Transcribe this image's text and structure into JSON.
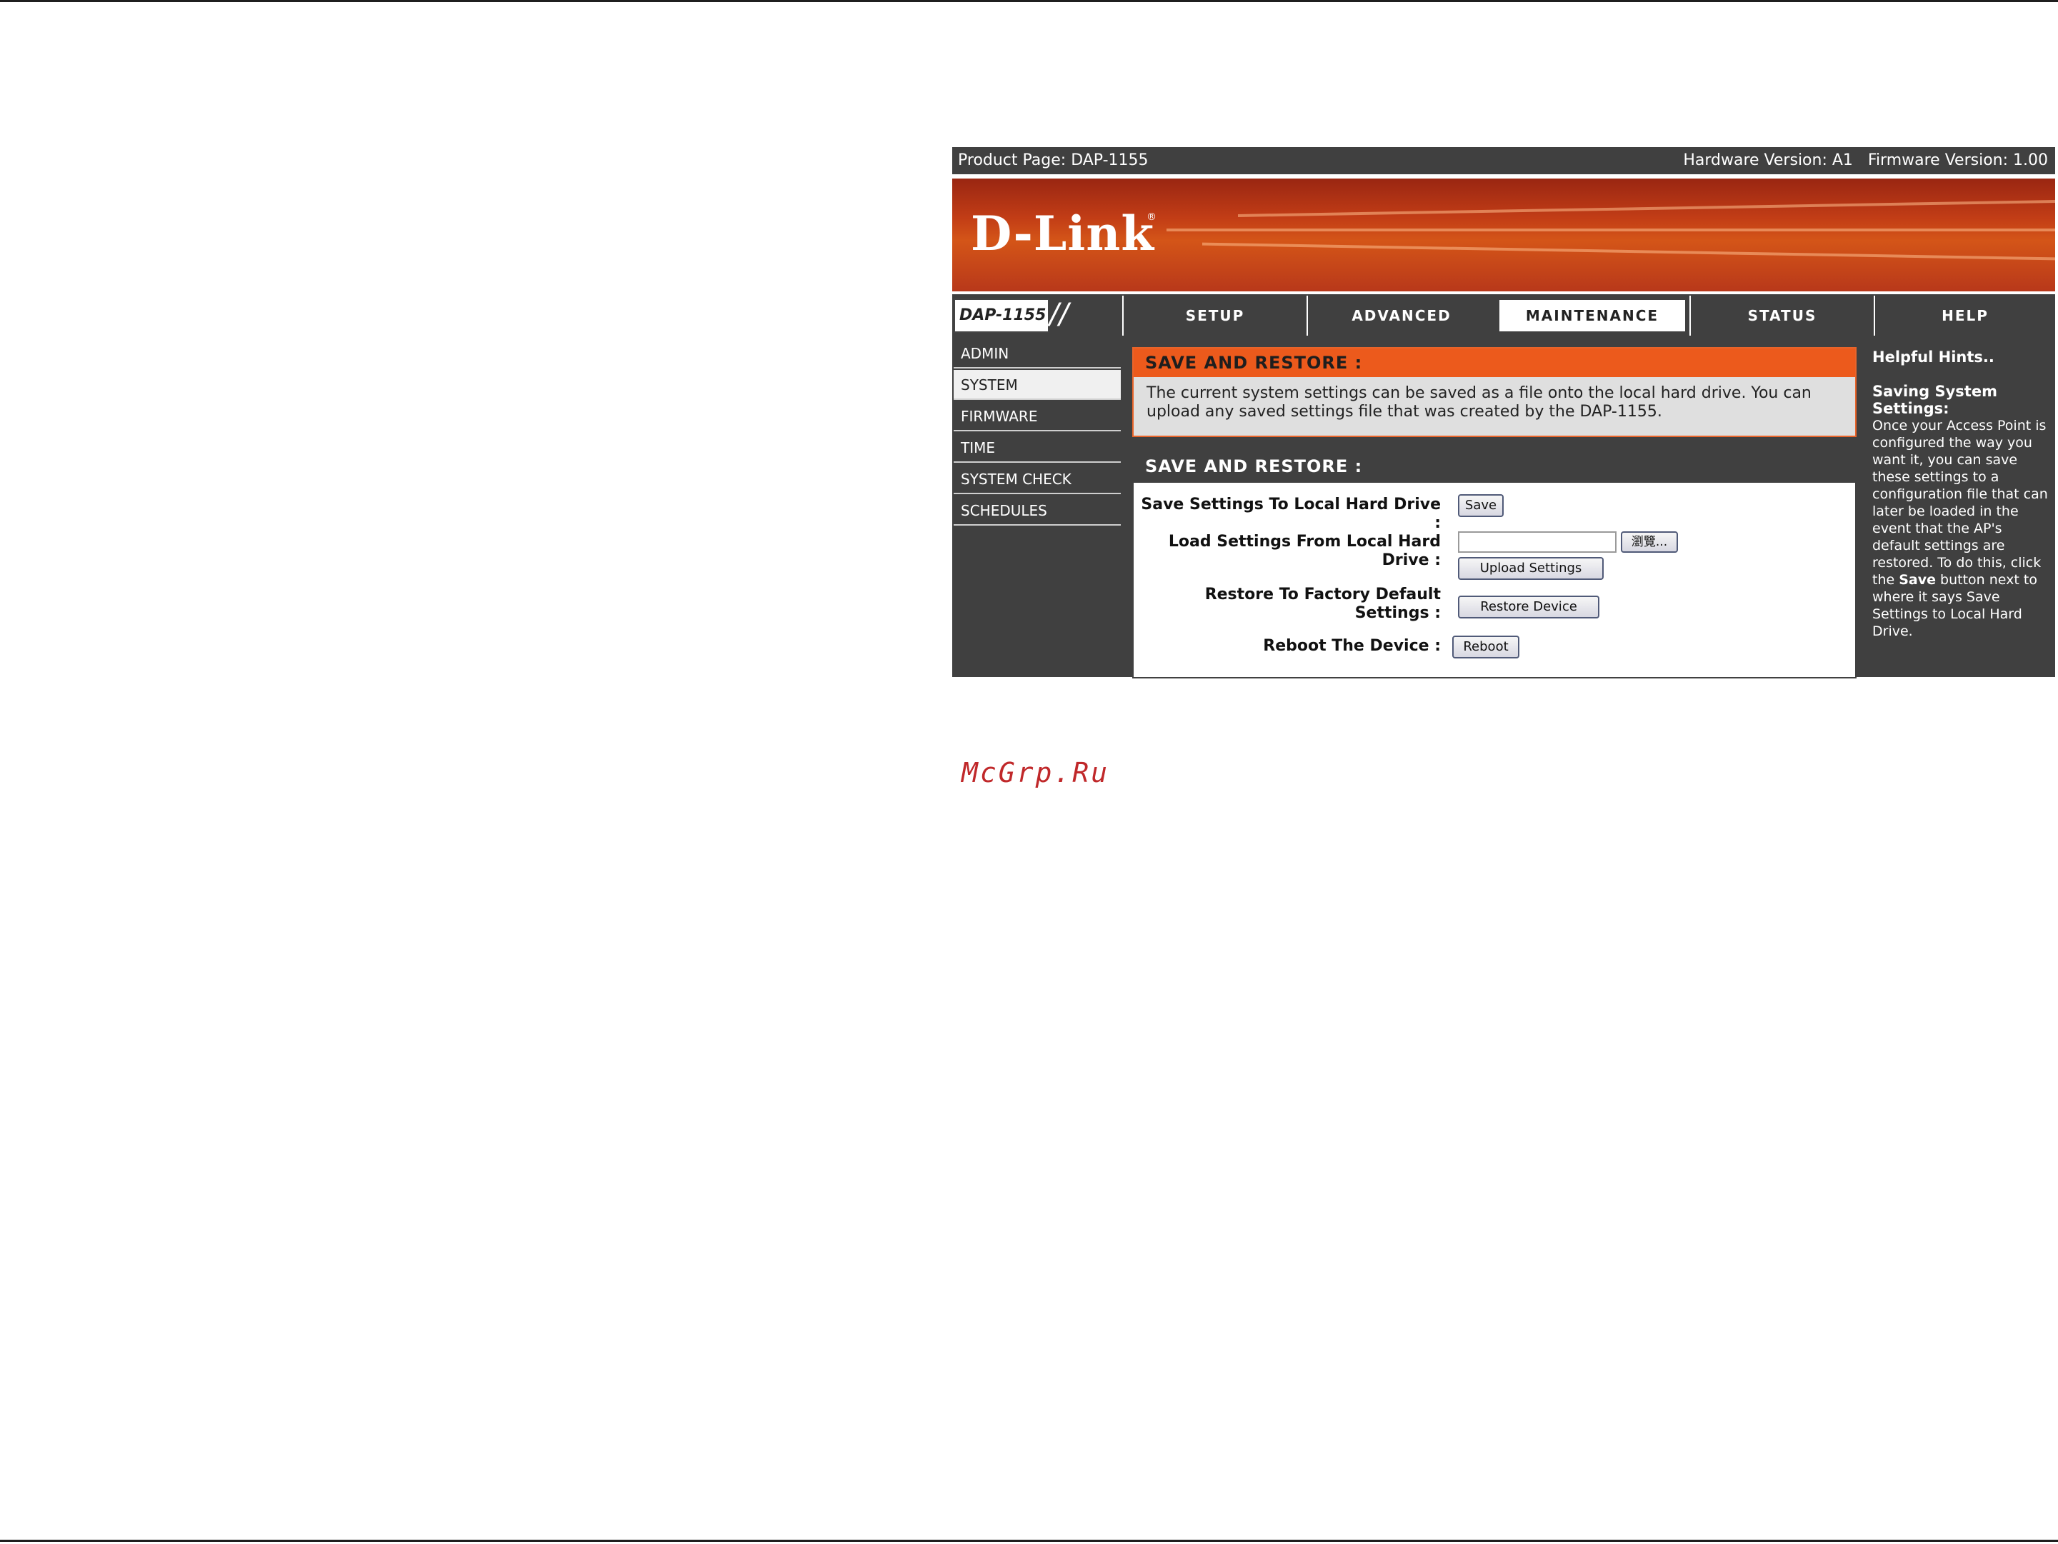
{
  "topbar": {
    "product_page": "Product Page: DAP-1155",
    "versions": "Hardware Version: A1   Firmware Version: 1.00"
  },
  "banner": {
    "logo": "D-Link",
    "reg_mark": "®"
  },
  "model": {
    "label": "DAP-1155",
    "slashes": "//"
  },
  "nav": {
    "tabs": [
      {
        "label": "SETUP"
      },
      {
        "label": "ADVANCED"
      },
      {
        "label": "MAINTENANCE"
      },
      {
        "label": "STATUS"
      },
      {
        "label": "HELP"
      }
    ]
  },
  "sidebar": {
    "items": [
      {
        "label": "ADMIN"
      },
      {
        "label": "SYSTEM"
      },
      {
        "label": "FIRMWARE"
      },
      {
        "label": "TIME"
      },
      {
        "label": "SYSTEM CHECK"
      },
      {
        "label": "SCHEDULES"
      }
    ]
  },
  "intro": {
    "title": "SAVE AND RESTORE :",
    "text": "The current system settings can be saved as a file onto the local hard drive. You can upload any saved settings file that was created by the DAP-1155."
  },
  "form": {
    "title": "SAVE AND RESTORE :",
    "save_label": "Save Settings To Local Hard Drive :",
    "save_button": "Save",
    "load_label": "Load Settings From Local Hard Drive :",
    "browse_button": "瀏覽...",
    "upload_button": "Upload Settings",
    "restore_label": "Restore To Factory Default Settings :",
    "restore_button": "Restore Device",
    "reboot_label": "Reboot The Device :",
    "reboot_button": "Reboot"
  },
  "hints": {
    "title": "Helpful Hints..",
    "subtitle": "Saving System Settings:",
    "body_pre": "Once your Access Point is configured the way you want it, you can save these settings to a configuration file that can later be loaded in the event that the AP's default settings are restored. To do this, click the ",
    "body_bold": "Save",
    "body_post": " button next to where it says Save Settings to Local Hard Drive."
  },
  "watermark": "McGrp.Ru",
  "colors": {
    "accent": "#ec5a1c",
    "panel": "#404040"
  }
}
